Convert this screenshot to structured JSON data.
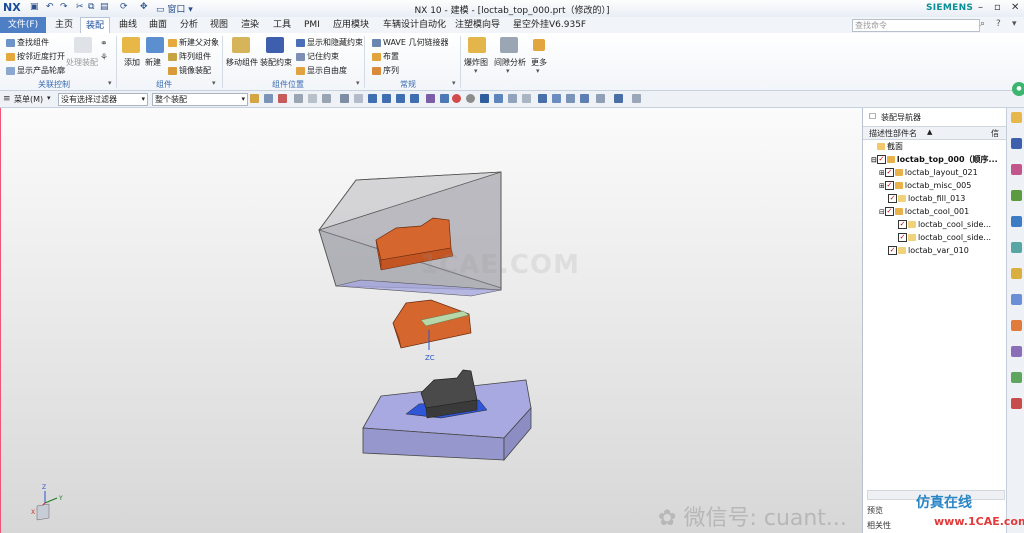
{
  "titlebar": {
    "logo": "NX",
    "window_title": "NX 10 - 建模 - [loctab_top_000.prt（修改的）]",
    "brand": "SIEMENS",
    "window_label": "窗口",
    "controls": [
      "–",
      "▫",
      "✕"
    ]
  },
  "menu": {
    "file": "文件(F)",
    "tabs": [
      "主页",
      "装配",
      "曲线",
      "曲面",
      "分析",
      "视图",
      "渲染",
      "工具",
      "PMI",
      "应用模块",
      "车辆设计自动化",
      "注塑模向导",
      "星空外挂V6.935F"
    ],
    "active_tab": "装配",
    "search_placeholder": "查找命令"
  },
  "ribbon": {
    "group1": {
      "items": [
        "查找组件",
        "按邻近度打开",
        "显示产品轮廓"
      ],
      "big": "处理装配",
      "label": "关联控制"
    },
    "group2": {
      "big1": "添加",
      "big2": "新建",
      "items": [
        "新建父对象",
        "阵列组件",
        "镜像装配"
      ],
      "label": "组件"
    },
    "group3": {
      "big1": "移动组件",
      "big2": "装配约束",
      "items": [
        "显示和隐藏约束",
        "记住约束",
        "显示自由度"
      ],
      "label": "组件位置"
    },
    "group4": {
      "items": [
        "WAVE 几何链接器",
        "布置",
        "序列"
      ],
      "label": "常规"
    },
    "group5": {
      "big1": "爆炸图",
      "big2": "间隙分析",
      "big3": "更多"
    }
  },
  "toolbar": {
    "menu_label": "菜单(M)",
    "filter": "没有选择过滤器",
    "scope": "整个装配"
  },
  "viewport": {
    "axis_label": "ZC",
    "triad_labels": [
      "Y",
      "X",
      "Z"
    ],
    "colors": {
      "part": "#d4662e",
      "box": "#808080",
      "base": "#a7a9e0",
      "block": "#4a4a4a"
    }
  },
  "navigator": {
    "title": "装配导航器",
    "column_name": "描述性部件名",
    "column_info": "信",
    "rows": [
      {
        "text": "截面",
        "indent": 0,
        "type": "folder"
      },
      {
        "text": "loctab_top_000（顺序...",
        "indent": 0,
        "type": "asm",
        "bold": true
      },
      {
        "text": "loctab_layout_021",
        "indent": 1,
        "type": "asm"
      },
      {
        "text": "loctab_misc_005",
        "indent": 1,
        "type": "asm"
      },
      {
        "text": "loctab_fill_013",
        "indent": 1,
        "type": "part"
      },
      {
        "text": "loctab_cool_001",
        "indent": 1,
        "type": "asm"
      },
      {
        "text": "loctab_cool_side...",
        "indent": 2,
        "type": "part"
      },
      {
        "text": "loctab_cool_side...",
        "indent": 2,
        "type": "part"
      },
      {
        "text": "loctab_var_010",
        "indent": 1,
        "type": "part"
      }
    ],
    "footer_preview": "预览",
    "footer_related": "相关性"
  },
  "watermarks": {
    "center": "1CAE.COM",
    "wechat": "微信号: cuant...",
    "site_cn": "仿真在线",
    "site_en": "www.1CAE.com"
  }
}
